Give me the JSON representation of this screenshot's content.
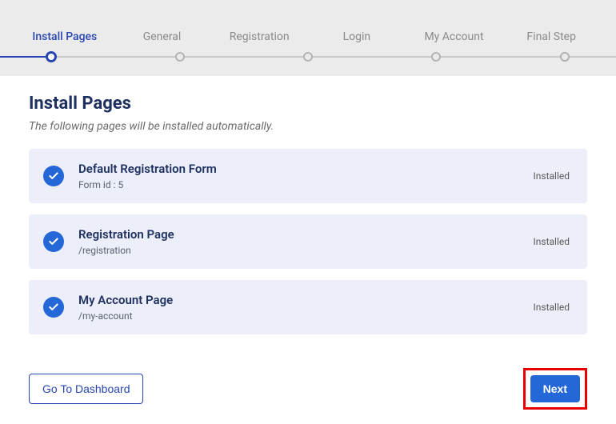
{
  "stepper": {
    "steps": [
      "Install Pages",
      "General",
      "Registration",
      "Login",
      "My Account",
      "Final Step"
    ],
    "active_index": 0
  },
  "header": {
    "title": "Install Pages",
    "description": "The following pages will be installed automatically."
  },
  "cards": [
    {
      "title": "Default Registration Form",
      "sub": "Form id : 5",
      "status": "Installed"
    },
    {
      "title": "Registration Page",
      "sub": "/registration",
      "status": "Installed"
    },
    {
      "title": "My Account Page",
      "sub": "/my-account",
      "status": "Installed"
    }
  ],
  "footer": {
    "dashboard_label": "Go To Dashboard",
    "next_label": "Next"
  }
}
